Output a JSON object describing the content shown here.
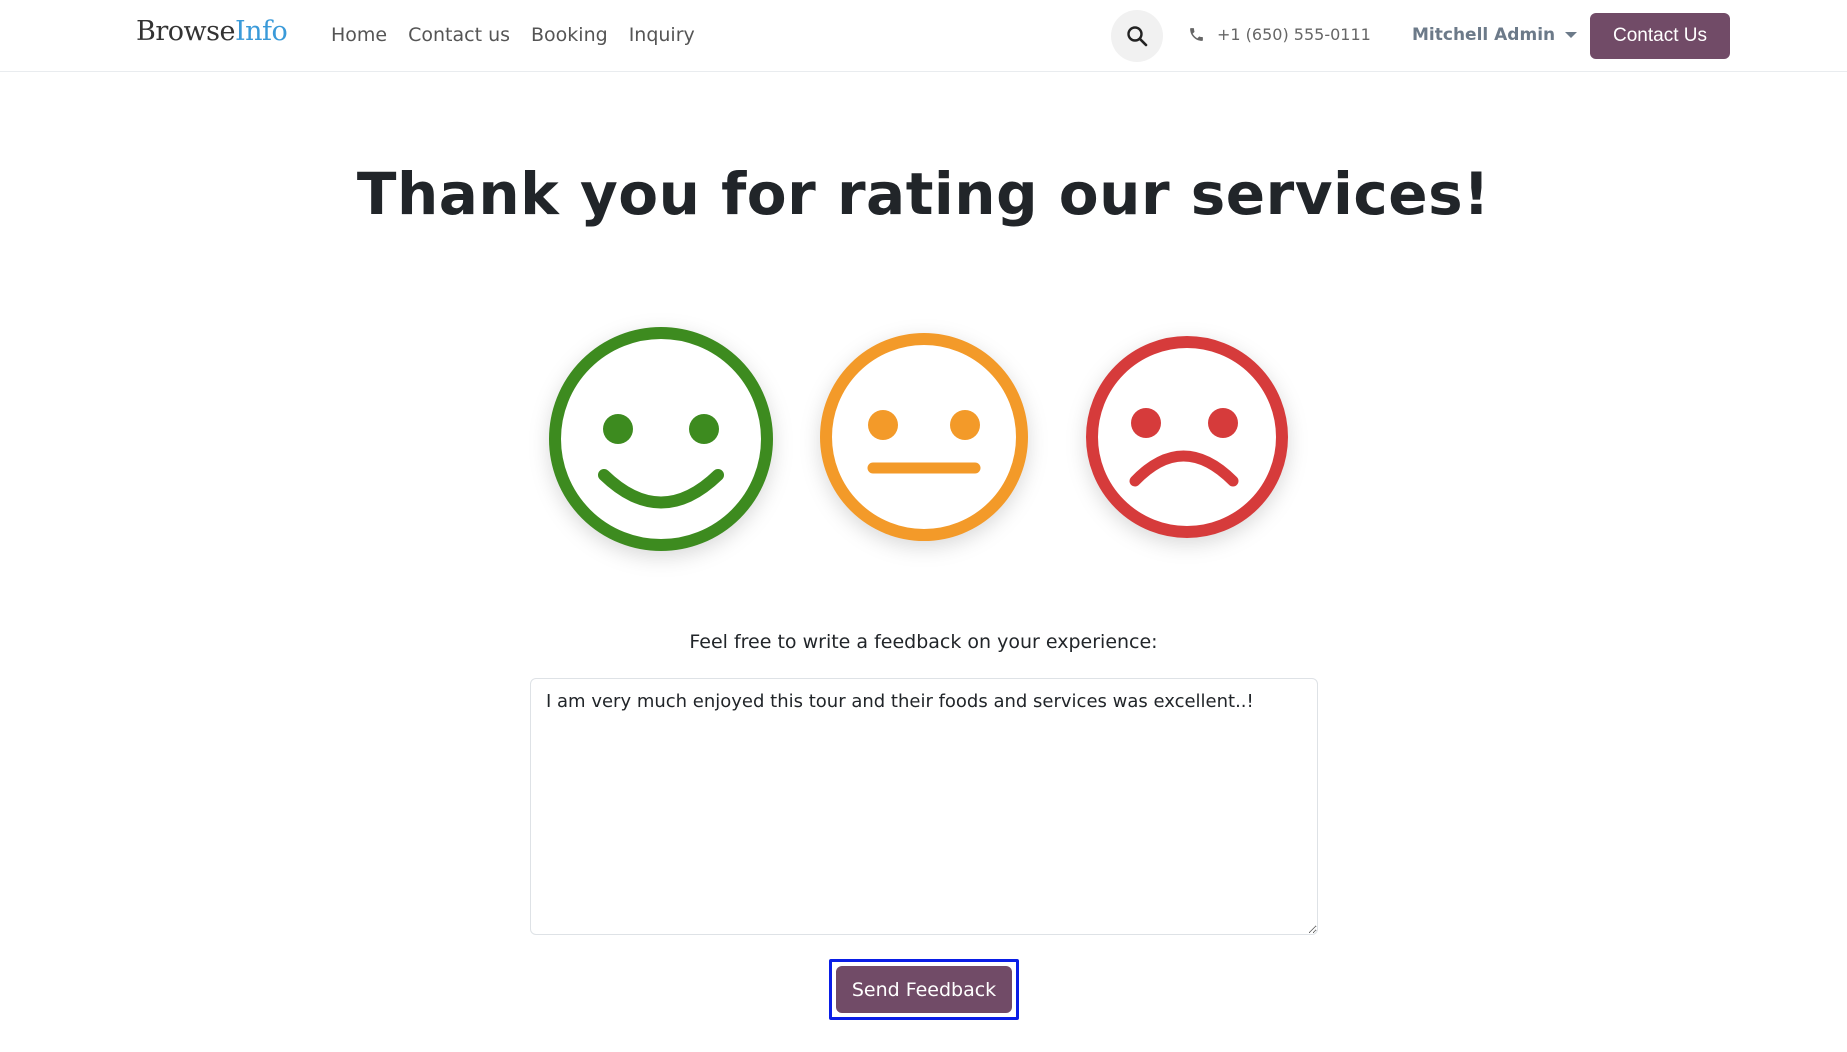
{
  "navbar": {
    "logo_part1": "Browse",
    "logo_part2": "Info",
    "links": [
      "Home",
      "Contact us",
      "Booking",
      "Inquiry"
    ],
    "phone": "+1 (650) 555-0111",
    "user": "Mitchell Admin",
    "contact_button": "Contact Us"
  },
  "main": {
    "title": "Thank you for rating our services!",
    "ratings": [
      {
        "mood": "happy",
        "color": "#3d8b1f",
        "icon": "happy-face-icon"
      },
      {
        "mood": "neutral",
        "color": "#f39a29",
        "icon": "neutral-face-icon"
      },
      {
        "mood": "sad",
        "color": "#d63b3b",
        "icon": "sad-face-icon"
      }
    ],
    "feedback_label": "Feel free to write a feedback on your experience:",
    "feedback_value": "I am very much enjoyed this tour and their foods and services was excellent..!",
    "send_button": "Send Feedback"
  },
  "colors": {
    "brand": "#714b67",
    "logo_accent": "#3a9ad9",
    "focus_outline": "#0a1ee6"
  }
}
